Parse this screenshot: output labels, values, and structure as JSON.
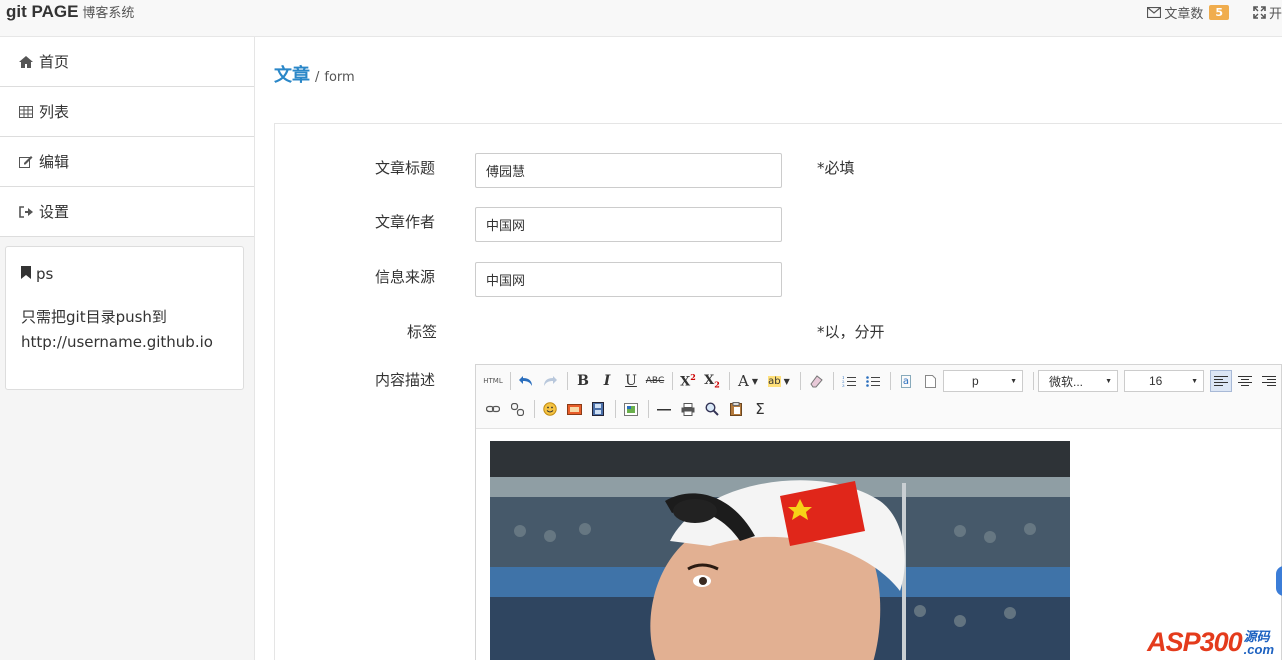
{
  "navbar": {
    "brand": "git PAGE",
    "brand_sub": "博客系统",
    "articles_label": "文章数",
    "articles_count": "5",
    "fullscreen_label": "开"
  },
  "sidebar": {
    "items": [
      {
        "label": "首页",
        "icon": "home-icon"
      },
      {
        "label": "列表",
        "icon": "table-icon"
      },
      {
        "label": "编辑",
        "icon": "edit-icon"
      },
      {
        "label": "设置",
        "icon": "sign-out-icon"
      }
    ],
    "panel": {
      "title": "ps",
      "line1": "只需把git目录push到",
      "line2": "http://username.github.io"
    }
  },
  "breadcrumb": {
    "active": "文章",
    "separator": "/",
    "leaf": "form"
  },
  "form": {
    "title_label": "文章标题",
    "title_value": "傅园慧",
    "title_hint": "*必填",
    "author_label": "文章作者",
    "author_value": "中国网",
    "source_label": "信息来源",
    "source_value": "中国网",
    "tags_label": "标签",
    "tags_hint": "*以，分开",
    "content_label": "内容描述"
  },
  "editor": {
    "paragraph_select": "p",
    "font_select": "微软...",
    "size_select": "16"
  },
  "watermark": {
    "main": "ASP300",
    "side_top": "源码",
    "side_bottom": ".com"
  },
  "colors": {
    "accent": "#2a87c8",
    "badge": "#f0ad4e"
  }
}
